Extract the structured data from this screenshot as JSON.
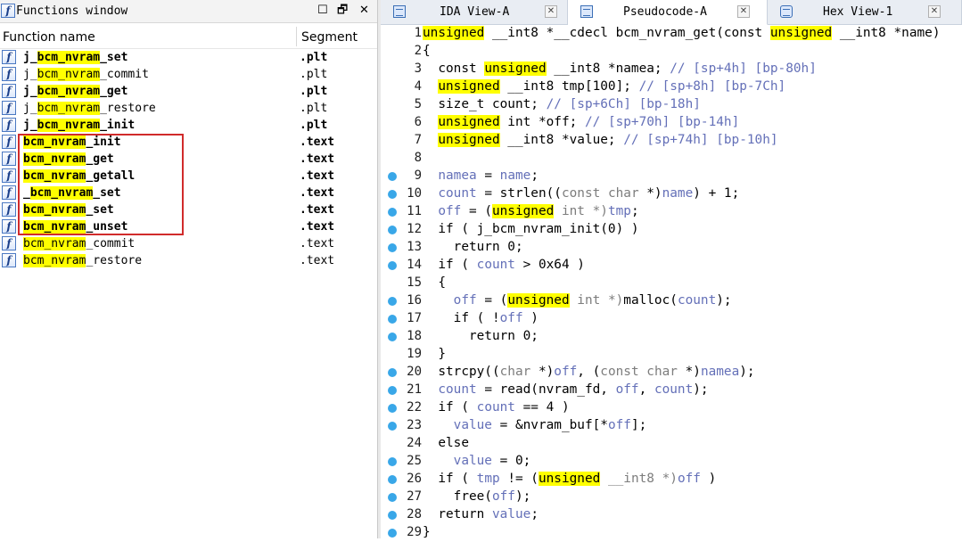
{
  "functions_window": {
    "title": "Functions window",
    "controls": {
      "minimize": "☐",
      "float": "🗗",
      "close": "✕"
    },
    "header": {
      "name_col": "Function name",
      "segment_col": "Segment"
    },
    "rows": [
      {
        "pre": "j_",
        "hl": "bcm_nvram",
        "post": "_set",
        "segment": ".plt",
        "bold": true
      },
      {
        "pre": "j_",
        "hl": "bcm_nvram",
        "post": "_commit",
        "segment": ".plt",
        "bold": false
      },
      {
        "pre": "j_",
        "hl": "bcm_nvram",
        "post": "_get",
        "segment": ".plt",
        "bold": true
      },
      {
        "pre": "j_",
        "hl": "bcm_nvram",
        "post": "_restore",
        "segment": ".plt",
        "bold": false
      },
      {
        "pre": "j_",
        "hl": "bcm_nvram",
        "post": "_init",
        "segment": ".plt",
        "bold": true
      },
      {
        "pre": "",
        "hl": "bcm_nvram",
        "post": "_init",
        "segment": ".text",
        "bold": true
      },
      {
        "pre": "",
        "hl": "bcm_nvram",
        "post": "_get",
        "segment": ".text",
        "bold": true
      },
      {
        "pre": "",
        "hl": "bcm_nvram",
        "post": "_getall",
        "segment": ".text",
        "bold": true
      },
      {
        "pre": "_",
        "hl": "bcm_nvram",
        "post": "_set",
        "segment": ".text",
        "bold": true
      },
      {
        "pre": "",
        "hl": "bcm_nvram",
        "post": "_set",
        "segment": ".text",
        "bold": true
      },
      {
        "pre": "",
        "hl": "bcm_nvram",
        "post": "_unset",
        "segment": ".text",
        "bold": true
      },
      {
        "pre": "",
        "hl": "bcm_nvram",
        "post": "_commit",
        "segment": ".text",
        "bold": false
      },
      {
        "pre": "",
        "hl": "bcm_nvram",
        "post": "_restore",
        "segment": ".text",
        "bold": false
      }
    ]
  },
  "tabs": [
    {
      "label": "IDA View-A",
      "active": false,
      "close": "✕"
    },
    {
      "label": "Pseudocode-A",
      "active": true,
      "close": "✕"
    },
    {
      "label": "Hex View-1",
      "active": false,
      "close": "✕"
    }
  ],
  "pseudocode": {
    "lines": [
      {
        "n": "1",
        "bp": false,
        "segs": [
          {
            "t": "unsigned",
            "c": "hl"
          },
          {
            "t": " __int8 *__cdecl bcm_nvram_get(const ",
            "c": "k"
          },
          {
            "t": "unsigned",
            "c": "hl"
          },
          {
            "t": " __int8 *name)",
            "c": "k"
          }
        ]
      },
      {
        "n": "2",
        "bp": false,
        "segs": [
          {
            "t": "{",
            "c": "k"
          }
        ]
      },
      {
        "n": "3",
        "bp": false,
        "segs": [
          {
            "t": "  const ",
            "c": "k"
          },
          {
            "t": "unsigned",
            "c": "hl"
          },
          {
            "t": " __int8 *namea; ",
            "c": "k"
          },
          {
            "t": "// [sp+4h] [bp-80h]",
            "c": "v"
          }
        ]
      },
      {
        "n": "4",
        "bp": false,
        "segs": [
          {
            "t": "  ",
            "c": "k"
          },
          {
            "t": "unsigned",
            "c": "hl"
          },
          {
            "t": " __int8 tmp[100]; ",
            "c": "k"
          },
          {
            "t": "// [sp+8h] [bp-7Ch]",
            "c": "v"
          }
        ]
      },
      {
        "n": "5",
        "bp": false,
        "segs": [
          {
            "t": "  size_t count; ",
            "c": "k"
          },
          {
            "t": "// [sp+6Ch] [bp-18h]",
            "c": "v"
          }
        ]
      },
      {
        "n": "6",
        "bp": false,
        "segs": [
          {
            "t": "  ",
            "c": "k"
          },
          {
            "t": "unsigned",
            "c": "hl"
          },
          {
            "t": " int *off; ",
            "c": "k"
          },
          {
            "t": "// [sp+70h] [bp-14h]",
            "c": "v"
          }
        ]
      },
      {
        "n": "7",
        "bp": false,
        "segs": [
          {
            "t": "  ",
            "c": "k"
          },
          {
            "t": "unsigned",
            "c": "hl"
          },
          {
            "t": " __int8 *value; ",
            "c": "k"
          },
          {
            "t": "// [sp+74h] [bp-10h]",
            "c": "v"
          }
        ]
      },
      {
        "n": "8",
        "bp": false,
        "segs": []
      },
      {
        "n": "9",
        "bp": true,
        "segs": [
          {
            "t": "  namea",
            "c": "v"
          },
          {
            "t": " = ",
            "c": "k"
          },
          {
            "t": "name",
            "c": "v"
          },
          {
            "t": ";",
            "c": "k"
          }
        ]
      },
      {
        "n": "10",
        "bp": true,
        "segs": [
          {
            "t": "  count",
            "c": "v"
          },
          {
            "t": " = strlen((",
            "c": "k"
          },
          {
            "t": "const char",
            "c": "g"
          },
          {
            "t": " *)",
            "c": "k"
          },
          {
            "t": "name",
            "c": "v"
          },
          {
            "t": ") + 1;",
            "c": "k"
          }
        ]
      },
      {
        "n": "11",
        "bp": true,
        "segs": [
          {
            "t": "  off",
            "c": "v"
          },
          {
            "t": " = (",
            "c": "k"
          },
          {
            "t": "unsigned",
            "c": "hl"
          },
          {
            "t": " int *)",
            "c": "g"
          },
          {
            "t": "tmp",
            "c": "v"
          },
          {
            "t": ";",
            "c": "k"
          }
        ]
      },
      {
        "n": "12",
        "bp": true,
        "segs": [
          {
            "t": "  if ( j_bcm_nvram_init(0) )",
            "c": "k"
          }
        ]
      },
      {
        "n": "13",
        "bp": true,
        "segs": [
          {
            "t": "    return 0;",
            "c": "k"
          }
        ]
      },
      {
        "n": "14",
        "bp": true,
        "segs": [
          {
            "t": "  if ( ",
            "c": "k"
          },
          {
            "t": "count",
            "c": "v"
          },
          {
            "t": " > 0x64 )",
            "c": "k"
          }
        ]
      },
      {
        "n": "15",
        "bp": false,
        "segs": [
          {
            "t": "  {",
            "c": "k"
          }
        ]
      },
      {
        "n": "16",
        "bp": true,
        "segs": [
          {
            "t": "    off",
            "c": "v"
          },
          {
            "t": " = (",
            "c": "k"
          },
          {
            "t": "unsigned",
            "c": "hl"
          },
          {
            "t": " int *)",
            "c": "g"
          },
          {
            "t": "malloc(",
            "c": "k"
          },
          {
            "t": "count",
            "c": "v"
          },
          {
            "t": ");",
            "c": "k"
          }
        ]
      },
      {
        "n": "17",
        "bp": true,
        "segs": [
          {
            "t": "    if ( !",
            "c": "k"
          },
          {
            "t": "off",
            "c": "v"
          },
          {
            "t": " )",
            "c": "k"
          }
        ]
      },
      {
        "n": "18",
        "bp": true,
        "segs": [
          {
            "t": "      return 0;",
            "c": "k"
          }
        ]
      },
      {
        "n": "19",
        "bp": false,
        "segs": [
          {
            "t": "  }",
            "c": "k"
          }
        ]
      },
      {
        "n": "20",
        "bp": true,
        "segs": [
          {
            "t": "  strcpy((",
            "c": "k"
          },
          {
            "t": "char",
            "c": "g"
          },
          {
            "t": " *)",
            "c": "k"
          },
          {
            "t": "off",
            "c": "v"
          },
          {
            "t": ", (",
            "c": "k"
          },
          {
            "t": "const char",
            "c": "g"
          },
          {
            "t": " *)",
            "c": "k"
          },
          {
            "t": "namea",
            "c": "v"
          },
          {
            "t": ");",
            "c": "k"
          }
        ]
      },
      {
        "n": "21",
        "bp": true,
        "segs": [
          {
            "t": "  count",
            "c": "v"
          },
          {
            "t": " = read(nvram_fd, ",
            "c": "k"
          },
          {
            "t": "off",
            "c": "v"
          },
          {
            "t": ", ",
            "c": "k"
          },
          {
            "t": "count",
            "c": "v"
          },
          {
            "t": ");",
            "c": "k"
          }
        ]
      },
      {
        "n": "22",
        "bp": true,
        "segs": [
          {
            "t": "  if ( ",
            "c": "k"
          },
          {
            "t": "count",
            "c": "v"
          },
          {
            "t": " == 4 )",
            "c": "k"
          }
        ]
      },
      {
        "n": "23",
        "bp": true,
        "segs": [
          {
            "t": "    value",
            "c": "v"
          },
          {
            "t": " = &nvram_buf[*",
            "c": "k"
          },
          {
            "t": "off",
            "c": "v"
          },
          {
            "t": "];",
            "c": "k"
          }
        ]
      },
      {
        "n": "24",
        "bp": false,
        "segs": [
          {
            "t": "  else",
            "c": "k"
          }
        ]
      },
      {
        "n": "25",
        "bp": true,
        "segs": [
          {
            "t": "    value",
            "c": "v"
          },
          {
            "t": " = 0;",
            "c": "k"
          }
        ]
      },
      {
        "n": "26",
        "bp": true,
        "segs": [
          {
            "t": "  if ( ",
            "c": "k"
          },
          {
            "t": "tmp",
            "c": "v"
          },
          {
            "t": " != (",
            "c": "k"
          },
          {
            "t": "unsigned",
            "c": "hl"
          },
          {
            "t": " __int8 *)",
            "c": "g"
          },
          {
            "t": "off",
            "c": "v"
          },
          {
            "t": " )",
            "c": "k"
          }
        ]
      },
      {
        "n": "27",
        "bp": true,
        "segs": [
          {
            "t": "    free(",
            "c": "k"
          },
          {
            "t": "off",
            "c": "v"
          },
          {
            "t": ");",
            "c": "k"
          }
        ]
      },
      {
        "n": "28",
        "bp": true,
        "segs": [
          {
            "t": "  return ",
            "c": "k"
          },
          {
            "t": "value",
            "c": "v"
          },
          {
            "t": ";",
            "c": "k"
          }
        ]
      },
      {
        "n": "29",
        "bp": true,
        "segs": [
          {
            "t": "}",
            "c": "k"
          }
        ]
      }
    ]
  },
  "colors": {
    "highlight": "#ffff00",
    "variable": "#6470b8",
    "cast": "#7d7d7d",
    "breakpoint": "#39a7e8",
    "annotation_box": "#d12b2b"
  },
  "icons": {
    "function": "function-icon",
    "tab": "tab-icon"
  }
}
